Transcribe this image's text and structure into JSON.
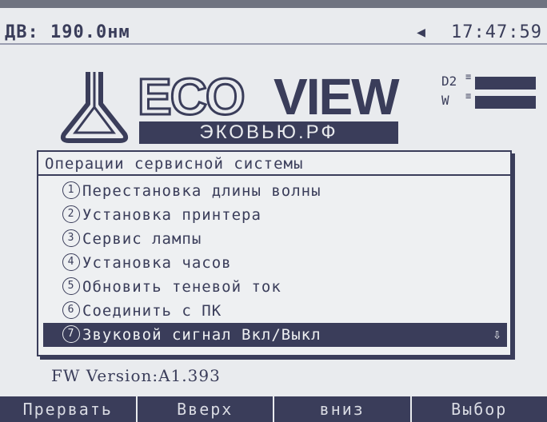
{
  "status": {
    "wavelength": "ДВ: 190.0нм",
    "speaker_icon": "speaker-icon",
    "time": "17:47:59"
  },
  "logo": {
    "eco": "ECO",
    "view": "VIEW",
    "domain": "ЭКОВЬЮ.РФ"
  },
  "lamps": [
    {
      "label": "D2",
      "state": "on"
    },
    {
      "label": "W",
      "state": "on"
    }
  ],
  "menu": {
    "title": "Операции сервисной системы",
    "items": [
      {
        "num": "1",
        "label": "Перестановка длины волны"
      },
      {
        "num": "2",
        "label": "Установка принтера"
      },
      {
        "num": "3",
        "label": "Сервис лампы"
      },
      {
        "num": "4",
        "label": "Установка часов"
      },
      {
        "num": "5",
        "label": "Обновить теневой ток"
      },
      {
        "num": "6",
        "label": "Соединить с ПК"
      },
      {
        "num": "7",
        "label": "Звуковой сигнал Вкл/Выкл",
        "selected": true
      }
    ],
    "scroll_icon": "arrow-down-icon"
  },
  "firmware": "FW Version:A1.393",
  "softkeys": [
    "Прервать",
    "Вверх",
    "вниз",
    "Выбор"
  ],
  "colors": {
    "screen": "#e9ebee",
    "ink": "#3a3d5a"
  }
}
